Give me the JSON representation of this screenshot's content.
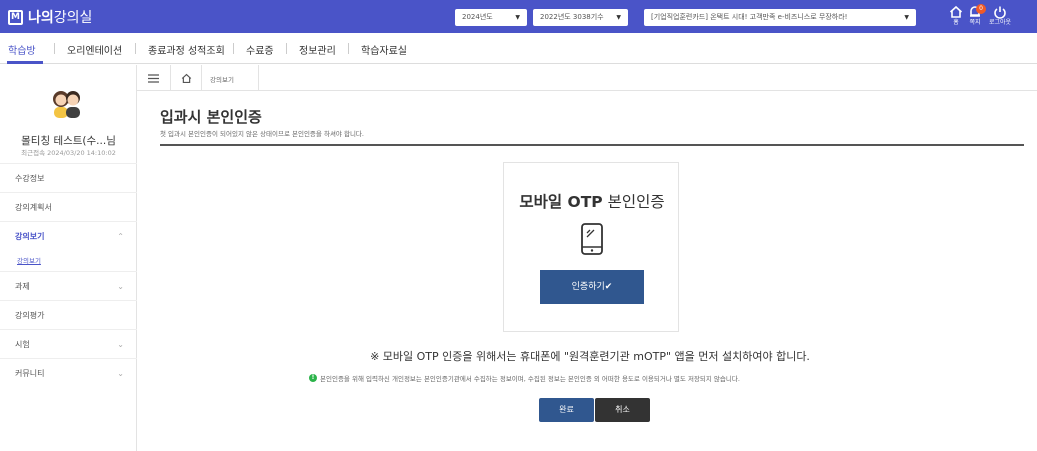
{
  "header": {
    "logo_mark": "M",
    "logo_bold": "나의",
    "logo_rest": "강의실",
    "select_year": "2024년도",
    "select_course": "2022년도 3038기수",
    "select_notice": "[기업직업훈련카드] 온택트 시대! 고객만족 e-비즈니스로 무장하라!",
    "home_label": "홈",
    "notice_label": "쪽지",
    "notice_count": "0",
    "logout_label": "로그아웃"
  },
  "menu": {
    "items": [
      "학습방",
      "오리엔테이션",
      "종료과정 성적조회",
      "수료증",
      "정보관리",
      "학습자료실"
    ]
  },
  "sidebar": {
    "user_name": "몰티칭 테스트(수...님",
    "last_login": "최근접속 2024/03/20 14:10:02",
    "items": [
      "수강정보",
      "강의계획서",
      "강의보기",
      "과제",
      "강의평가",
      "시험",
      "커뮤니티"
    ],
    "sub_item": "강의보기"
  },
  "breadcrumb": {
    "current": "강의보기"
  },
  "main": {
    "title": "입과시 본인인증",
    "description": "첫 입과시 본인인증이 되어있지 않은 상태이므로 본인인증을 하셔야 합니다.",
    "card_title_bold": "모바일 OTP",
    "card_title_rest": " 본인인증",
    "auth_button": "인증하기✔",
    "notice": "※ 모바일 OTP 인증을 위해서는 휴대폰에 \"원격훈련기관 mOTP\" 앱을 먼저 설치하여야 합니다.",
    "privacy_text": "본인인증을 위해 입력하신 개인정보는 본인인증기관에서 수집하는 정보이며, 수집된 정보는 본인인증 외 어떠한 용도로 이용되거나 별도 저장되지 않습니다.",
    "done_button": "완료",
    "cancel_button": "취소"
  },
  "colors": {
    "brand": "#4a54c8",
    "button_blue": "#30578f",
    "button_dark": "#333333",
    "badge": "#f05a28"
  }
}
